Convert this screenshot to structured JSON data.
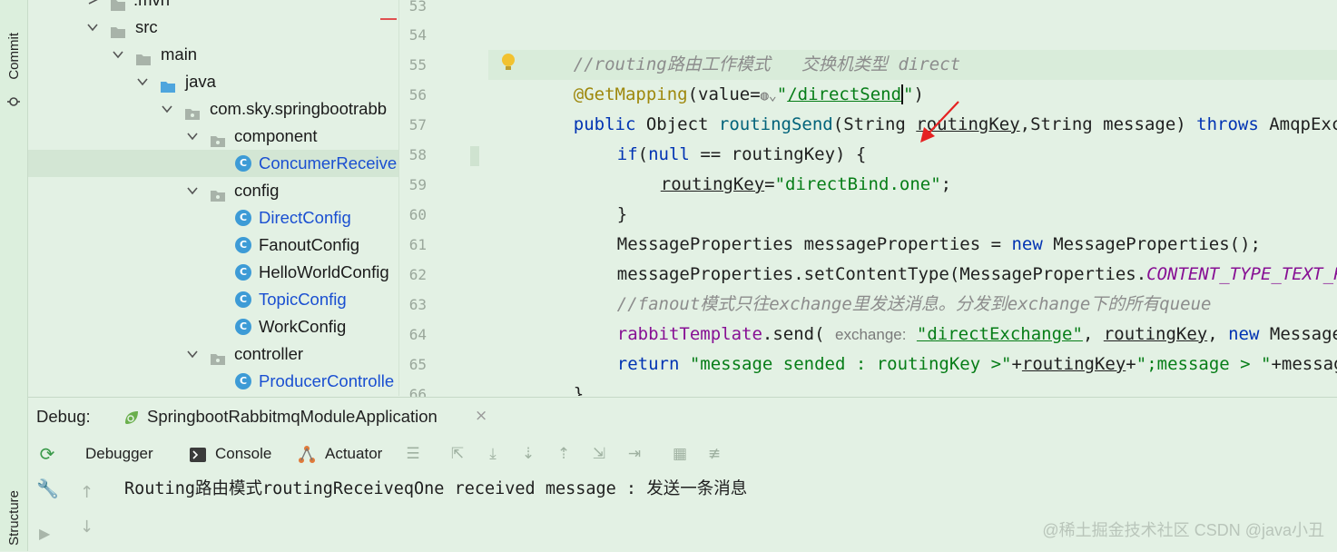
{
  "side_tabs": {
    "commit": "Commit",
    "structure": "Structure"
  },
  "tree": {
    "rows": [
      {
        "label": ".mvn",
        "kind": "folder"
      },
      {
        "label": "src",
        "kind": "folder"
      },
      {
        "label": "main",
        "kind": "folder"
      },
      {
        "label": "java",
        "kind": "folder"
      },
      {
        "label": "com.sky.springbootrabb",
        "kind": "package"
      },
      {
        "label": "component",
        "kind": "package"
      },
      {
        "label": "ConcumerReceive",
        "kind": "class"
      },
      {
        "label": "config",
        "kind": "package"
      },
      {
        "label": "DirectConfig",
        "kind": "class"
      },
      {
        "label": "FanoutConfig",
        "kind": "class"
      },
      {
        "label": "HelloWorldConfig",
        "kind": "class"
      },
      {
        "label": "TopicConfig",
        "kind": "class"
      },
      {
        "label": "WorkConfig",
        "kind": "class"
      },
      {
        "label": "controller",
        "kind": "package"
      },
      {
        "label": "ProducerControlle",
        "kind": "class"
      }
    ],
    "class_icon_letter": "C"
  },
  "editor": {
    "line_numbers": [
      "53",
      "54",
      "55",
      "56",
      "57",
      "58",
      "59",
      "60",
      "61",
      "62",
      "63",
      "64",
      "65",
      "66"
    ],
    "lines": {
      "l54_comment": "//routing路由工作模式   交换机类型 direct",
      "l55_ann": "@GetMapping",
      "l55_open": "(value=",
      "l55_str_q1": "\"",
      "l55_str": "/directSend",
      "l55_str_q2": "\"",
      "l55_close": ")",
      "l56_public": "public",
      "l56_type": " Object ",
      "l56_fn": "routingSend",
      "l56_params_a": "(String ",
      "l56_param": "routingKey",
      "l56_params_b": ",String message) ",
      "l56_throws": "throws",
      "l56_exc": " AmqpExc",
      "l57_if": "if",
      "l57_paren": "(",
      "l57_null": "null",
      "l57_rest_a": " == routingKey) {",
      "l58_var": "routingKey",
      "l58_eq": "=",
      "l58_str": "\"directBind.one\"",
      "l58_semi": ";",
      "l59": "}",
      "l60_a": "MessageProperties messageProperties = ",
      "l60_new": "new",
      "l60_b": " MessageProperties();",
      "l61_a": "messageProperties.setContentType(MessageProperties.",
      "l61_const": "CONTENT_TYPE_TEXT_P",
      "l62_comment": "//fanout模式只往exchange里发送消息。分发到exchange下的所有queue",
      "l63_field": "rabbitTemplate",
      "l63_a": ".send( ",
      "l63_hint": "exchange:",
      "l63_sp": " ",
      "l63_str": "\"directExchange\"",
      "l63_b": ", ",
      "l63_var": "routingKey",
      "l63_c": ", ",
      "l63_new": "new",
      "l63_d": " Message",
      "l64_return": "return",
      "l64_str1": " \"message sended : routingKey >\"",
      "l64_plus": "+",
      "l64_var": "routingKey",
      "l64_plus2": "+",
      "l64_str2": "\";message > \"",
      "l64_tail": "+messag",
      "l65": "}"
    }
  },
  "debug": {
    "label": "Debug:",
    "run_config": "SpringbootRabbitmqModuleApplication",
    "tabs": {
      "debugger": "Debugger",
      "console": "Console",
      "actuator": "Actuator"
    },
    "console_output": "Routing路由模式routingReceiveqOne received message : 发送一条消息",
    "watermark": "@稀土掘金技术社区",
    "watermark2": "CSDN @java小丑"
  },
  "colors": {
    "background": "#e3f1e4",
    "keyword": "#0033b3",
    "string": "#067d17",
    "annotation": "#9e880d",
    "comment": "#8c8c8c",
    "class_icon": "#3d9bd6",
    "arrow": "#e52222"
  }
}
